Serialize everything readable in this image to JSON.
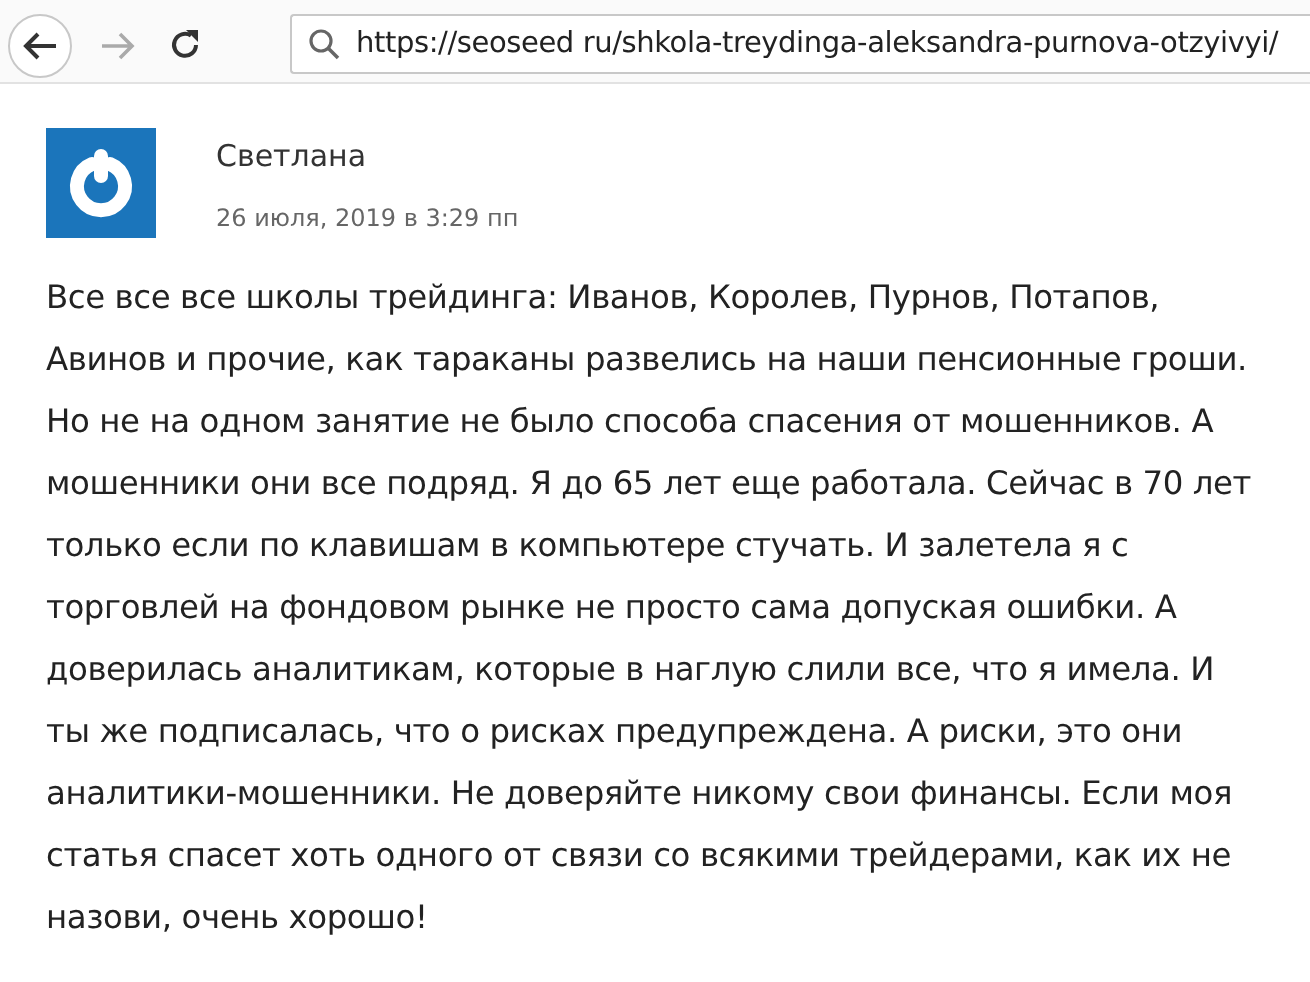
{
  "browser": {
    "url": "https://seoseed ru/shkola-treydinga-aleksandra-purnova-otzyivyi/"
  },
  "comment": {
    "author": "Светлана",
    "date": "26 июля, 2019 в 3:29 пп",
    "text": "Все все все школы трейдинга: Иванов, Королев, Пурнов, Потапов, Авинов и прочие, как тараканы развелись на наши пенсионные гроши. Но не на одном занятие не было способа спасения от мошенников. А мошенники они все подряд. Я до 65 лет еще работала. Сейчас в 70 лет только если по клавишам в компьютере стучать. И залетела я с торговлей на фондовом рынке не просто сама допуская ошибки. А доверилась аналитикам, которые в наглую слили все, что я имела. И ты же подписалась, что о рисках предупреждена. А риски, это они аналитики-мошенники. Не доверяйте никому свои финансы. Если моя статья спасет хоть одного от связи со всякими трейдерами, как их не назови, очень хорошо!"
  }
}
